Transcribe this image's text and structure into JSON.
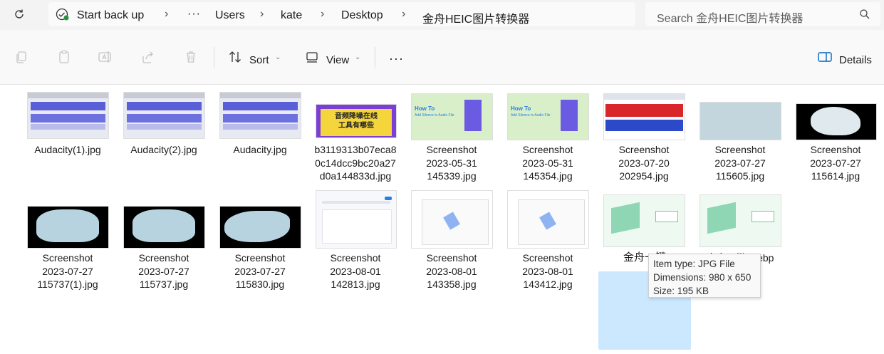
{
  "address_bar": {
    "crumbs": [
      "Start back up",
      "Users",
      "kate",
      "Desktop",
      "金舟HEIC图片转换器"
    ],
    "overflow": "···",
    "search_placeholder": "Search 金舟HEIC图片转换器"
  },
  "toolbar": {
    "sort_label": "Sort",
    "view_label": "View",
    "more": "···",
    "details_label": "Details"
  },
  "files": [
    {
      "lines": [
        "Audacity(1).jpg"
      ]
    },
    {
      "lines": [
        "Audacity(2).jpg"
      ]
    },
    {
      "lines": [
        "Audacity.jpg"
      ]
    },
    {
      "lines": [
        "b3119313b07eca8",
        "0c14dcc9bc20a27",
        "d0a144833d.jpg"
      ]
    },
    {
      "lines": [
        "Screenshot",
        "2023-05-31",
        "145339.jpg"
      ]
    },
    {
      "lines": [
        "Screenshot",
        "2023-05-31",
        "145354.jpg"
      ]
    },
    {
      "lines": [
        "Screenshot",
        "2023-07-20",
        "202954.jpg"
      ]
    },
    {
      "lines": [
        "Screenshot",
        "2023-07-27",
        "115605.jpg"
      ]
    },
    {
      "lines": [
        "Screenshot",
        "2023-07-27",
        "115614.jpg"
      ]
    },
    {
      "lines": [
        "Screenshot",
        "2023-07-27",
        "115737(1).jpg"
      ]
    },
    {
      "lines": [
        "Screenshot",
        "2023-07-27",
        "115737.jpg"
      ]
    },
    {
      "lines": [
        "Screenshot",
        "2023-07-27",
        "115830.jpg"
      ]
    },
    {
      "lines": [
        "Screenshot",
        "2023-08-01",
        "142813.jpg"
      ]
    },
    {
      "lines": [
        "Screenshot",
        "2023-08-01",
        "143358.jpg"
      ]
    },
    {
      "lines": [
        "Screenshot",
        "2023-08-01",
        "143412.jpg"
      ]
    },
    {
      "lines": [
        "金舟一键"
      ]
    },
    {
      "lines": [
        "金舟一键... ebp"
      ]
    }
  ],
  "thumb_text": {
    "banner_line1": "音频降噪在线",
    "banner_line2": "工具有哪些",
    "howto": "How To",
    "howto_sub": "Add Silence to Audio File"
  },
  "tooltip": {
    "type": "Item type: JPG File",
    "dimensions": "Dimensions: 980 x 650",
    "size": "Size: 195 KB"
  },
  "colors": {
    "selected_bg": "#cce8ff",
    "accent": "#0067c0"
  }
}
